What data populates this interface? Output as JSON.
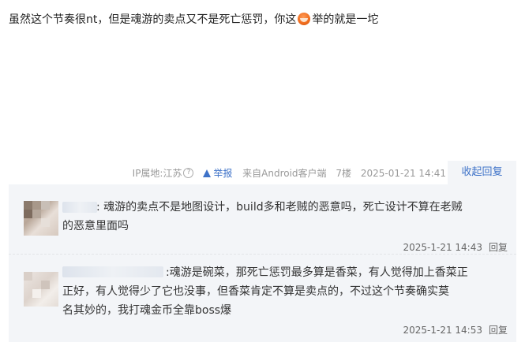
{
  "post": {
    "content_before_emoji": "虽然这个节奏很nt，但是魂游的卖点又不是死亡惩罚，你这",
    "emoji": "hehe-emoji-icon",
    "content_after_emoji": "举的就是一坨",
    "ip_location": "IP属地:江苏",
    "help_glyph": "?",
    "report_label": "举报",
    "source": "来自Android客户端",
    "floor": "7楼",
    "time": "2025-01-21 14:41",
    "collapse_label": "收起回复"
  },
  "replies": [
    {
      "text_line1": ": 魂游的卖点不是地图设计，build多和老贼的恶意吗，死亡设计不算在老贼",
      "text_line2": "的恶意里面吗",
      "time": "2025-1-21 14:43",
      "reply_label": "回复"
    },
    {
      "text_line1": ":魂游是碗菜，那死亡惩罚最多算是香菜，有人觉得加上香菜正",
      "text_line2": "正好，有人觉得少了它也没事，但香菜肯定不算是卖点的，不过这个节奏确实莫",
      "text_line3": "名其妙的，我打魂金币全靠boss爆",
      "time": "2025-1-21 14:53",
      "reply_label": "回复"
    }
  ],
  "colors": {
    "link": "#3e72c8",
    "reply_bg": "#f3f5f8",
    "meta_gray": "#999999"
  }
}
